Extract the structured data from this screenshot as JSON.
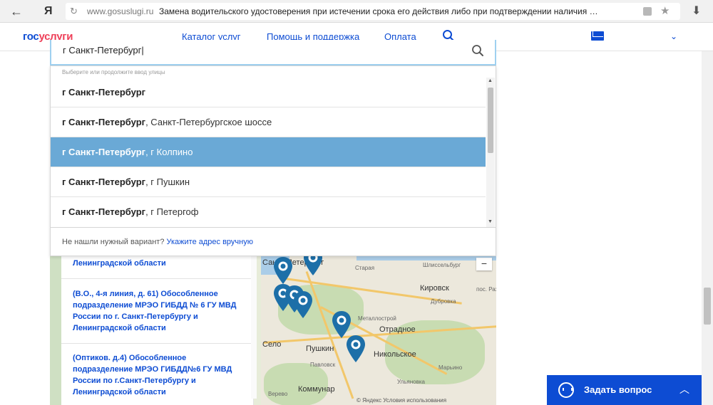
{
  "browser": {
    "back_glyph": "←",
    "yandex_logo": "Я",
    "url_icon": "↻",
    "domain": "www.gosuslugi.ru",
    "page_title": "Замена водительского удостоверения при истечении срока его действия либо при подтверждении наличия …",
    "star_glyph": "★",
    "download_glyph": "⬇"
  },
  "header": {
    "logo_part1": "гос",
    "logo_part2": "услуги",
    "nav": [
      "Каталог услуг",
      "Помощь и поддержка",
      "Оплата"
    ],
    "chevron": "⌄"
  },
  "search": {
    "value": "г Санкт-Петербург"
  },
  "dropdown": {
    "hint": "Выберите или продолжите ввод улицы",
    "options": [
      {
        "bold": "г Санкт-Петербург",
        "rest": ""
      },
      {
        "bold": "г Санкт-Петербург",
        "rest": ", Санкт-Петербургское шоссе"
      },
      {
        "bold": "г Санкт-Петербург",
        "rest": ", г Колпино"
      },
      {
        "bold": "г Санкт-Петербург",
        "rest": ", г Пушкин"
      },
      {
        "bold": "г Санкт-Петербург",
        "rest": ", г Петергоф"
      }
    ],
    "active_index": 2,
    "footer_text": "Не нашли нужный вариант? ",
    "footer_link": "Укажите адрес вручную"
  },
  "offices": [
    {
      "text": "Ленинградской области"
    },
    {
      "text": "(В.О., 4-я линия, д. 61) Обособленное подразделение МРЭО ГИБДД № 6 ГУ МВД России по г. Санкт-Петербургу и Ленинградской области"
    },
    {
      "text": "(Оптиков. д.4) Обособленное подразделение МРЭО ГИБДД№6 ГУ МВД России по г.Санкт-Петербургу и Ленинградской области"
    }
  ],
  "map": {
    "labels": [
      "Санкт-Петербург",
      "Старая",
      "Шлиссельбург",
      "Кировск",
      "Дубровка",
      "Металлострой",
      "Отрадное",
      "Пушкин",
      "Никольское",
      "Павловск",
      "Коммунар",
      "Село",
      "Ульяновка",
      "Марьино",
      "пос. Рах",
      "Верево"
    ],
    "zoom_minus": "−",
    "copyright": "© Яндекс Условия использования"
  },
  "ask_widget": {
    "label": "Задать вопрос",
    "chevron": "︿"
  },
  "colors": {
    "brand_blue": "#0d4cd3",
    "brand_red": "#ee3f58",
    "active_row": "#6aa9d6",
    "pin": "#1d6fa8"
  }
}
